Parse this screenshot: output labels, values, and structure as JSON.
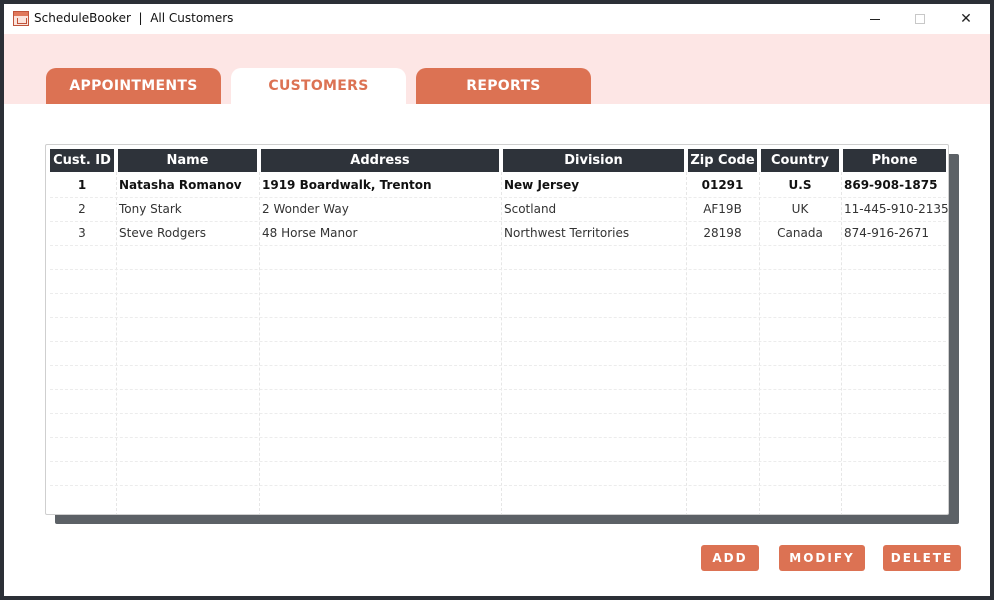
{
  "window": {
    "title": "ScheduleBooker  |  All Customers"
  },
  "tabs": [
    {
      "label": "APPOINTMENTS",
      "active": false
    },
    {
      "label": "CUSTOMERS",
      "active": true
    },
    {
      "label": "REPORTS",
      "active": false
    }
  ],
  "table": {
    "columns": [
      "Cust. ID",
      "Name",
      "Address",
      "Division",
      "Zip Code",
      "Country",
      "Phone"
    ],
    "rows": [
      {
        "id": "1",
        "name": "Natasha Romanov",
        "address": "1919 Boardwalk, Trenton",
        "division": "New Jersey",
        "zip": "01291",
        "country": "U.S",
        "phone": "869-908-1875",
        "selected": true
      },
      {
        "id": "2",
        "name": "Tony Stark",
        "address": "2 Wonder Way",
        "division": "Scotland",
        "zip": "AF19B",
        "country": "UK",
        "phone": "11-445-910-2135",
        "selected": false
      },
      {
        "id": "3",
        "name": "Steve Rodgers",
        "address": "48 Horse Manor",
        "division": "Northwest Territories",
        "zip": "28198",
        "country": "Canada",
        "phone": "874-916-2671",
        "selected": false
      }
    ]
  },
  "buttons": {
    "add": "ADD",
    "modify": "MODIFY",
    "delete": "DELETE"
  },
  "colors": {
    "accent": "#dc7253",
    "band": "#fde6e5",
    "header": "#2e333a"
  }
}
